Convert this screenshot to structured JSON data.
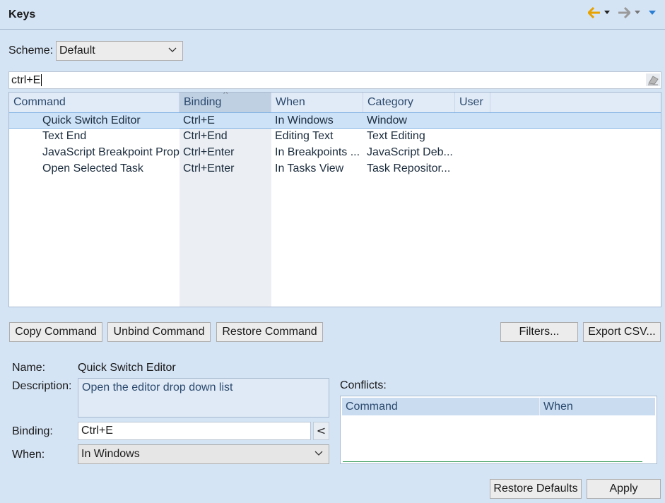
{
  "header": {
    "title": "Keys"
  },
  "scheme": {
    "label": "Scheme:",
    "value": "Default"
  },
  "filter": {
    "value": "ctrl+E"
  },
  "table": {
    "columns": [
      "Command",
      "Binding",
      "When",
      "Category",
      "User"
    ],
    "rows": [
      {
        "command": "Quick Switch Editor",
        "binding": "Ctrl+E",
        "when": "In Windows",
        "category": "Window",
        "selected": true
      },
      {
        "command": "Text End",
        "binding": "Ctrl+End",
        "when": "Editing Text",
        "category": "Text Editing"
      },
      {
        "command": "JavaScript Breakpoint Prop",
        "binding": "Ctrl+Enter",
        "when": "In Breakpoints ...",
        "category": "JavaScript Deb..."
      },
      {
        "command": "Open Selected Task",
        "binding": "Ctrl+Enter",
        "when": "In Tasks View",
        "category": "Task Repositor..."
      }
    ]
  },
  "buttons": {
    "copy_command": "Copy Command",
    "unbind_command": "Unbind Command",
    "restore_command": "Restore Command",
    "filters": "Filters...",
    "export_csv": "Export CSV...",
    "restore_defaults": "Restore Defaults",
    "apply": "Apply"
  },
  "details": {
    "name_label": "Name:",
    "name_value": "Quick Switch Editor",
    "description_label": "Description:",
    "description_value": "Open the editor drop down list",
    "binding_label": "Binding:",
    "binding_value": "Ctrl+E",
    "binding_button": "<",
    "when_label": "When:",
    "when_value": "In Windows"
  },
  "conflicts": {
    "label": "Conflicts:",
    "columns": [
      "Command",
      "When"
    ]
  }
}
